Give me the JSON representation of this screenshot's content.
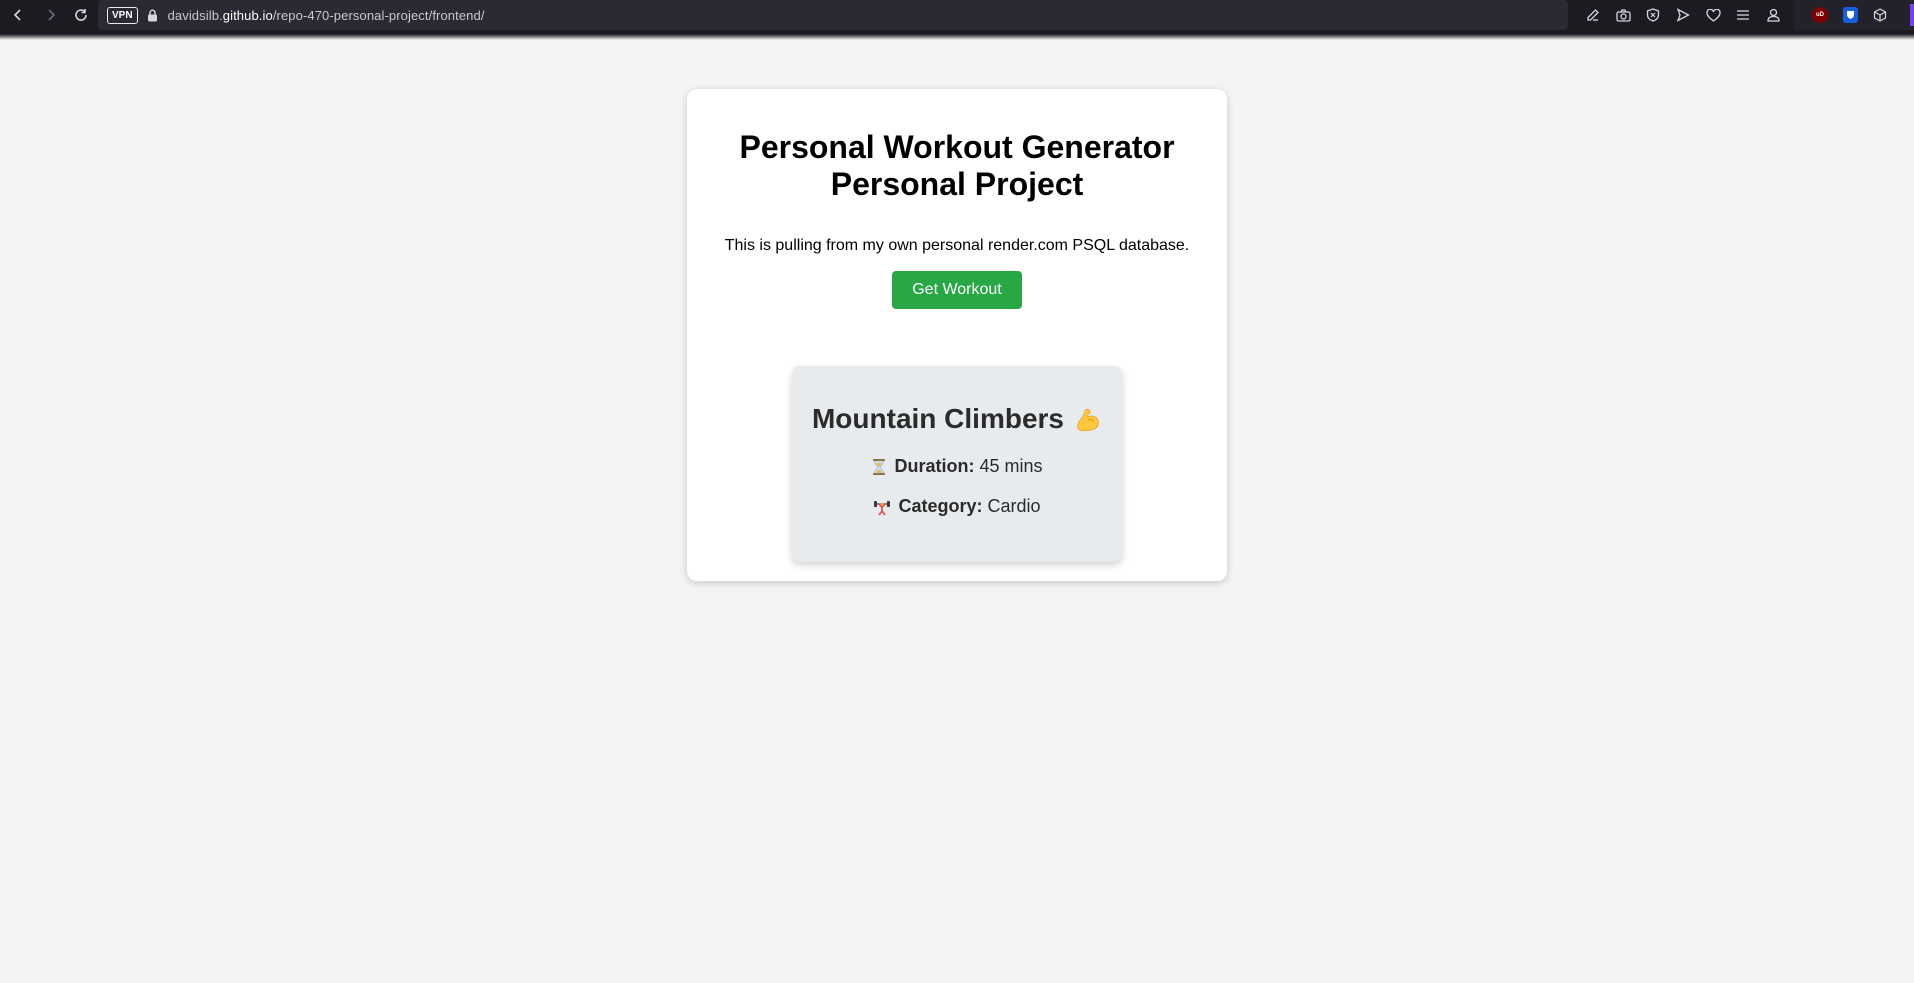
{
  "browser": {
    "vpn_label": "VPN",
    "url_host_prefix": "davidsilb.",
    "url_host": "github.io",
    "url_path": "/repo-470-personal-project/frontend/",
    "ublock_label": "uD"
  },
  "page": {
    "title_line1": "Personal Workout Generator",
    "title_line2": "Personal Project",
    "subtitle": "This is pulling from my own personal render.com PSQL database.",
    "button_label": "Get Workout"
  },
  "workout": {
    "name": "Mountain Climbers",
    "duration_label": "Duration:",
    "duration_value": "45 mins",
    "category_label": "Category:",
    "category_value": "Cardio",
    "name_icon": "flexed-biceps-icon",
    "duration_icon": "hourglass-icon",
    "category_icon": "weight-lifting-icon"
  },
  "colors": {
    "button": "#28a745",
    "background": "#f4f4f4",
    "workout_card": "#e8ebee",
    "browser_chrome": "#1c1b22"
  }
}
